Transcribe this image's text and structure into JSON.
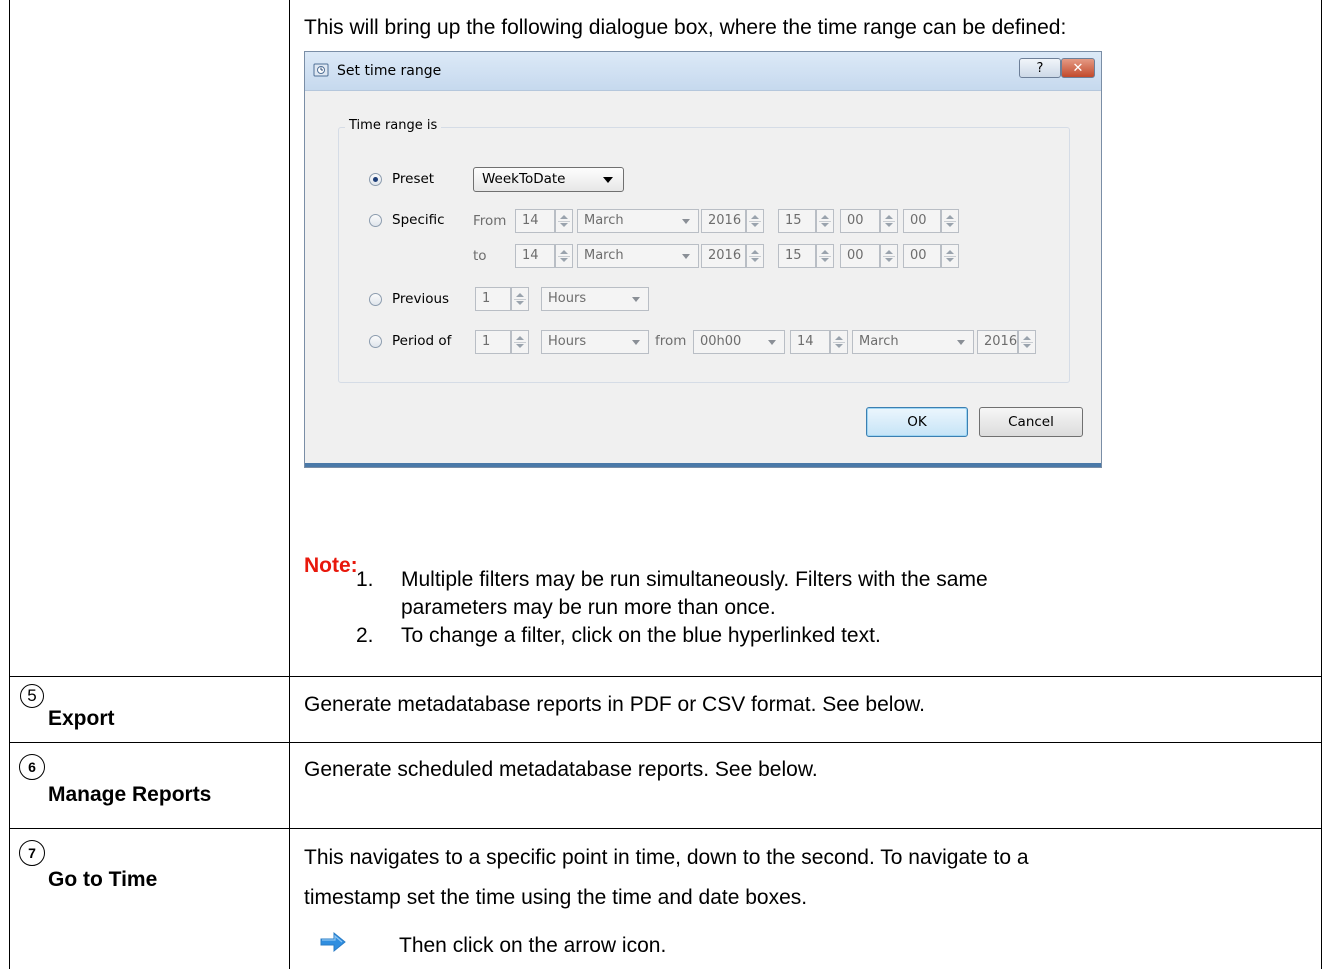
{
  "intro_text": "This will bring up the following dialogue box, where the time range can be defined:",
  "dialog": {
    "title": "Set time range",
    "help_button": "?",
    "close_button": "✕",
    "group_label": "Time range is",
    "preset": {
      "label": "Preset",
      "value": "WeekToDate"
    },
    "specific": {
      "label": "Specific",
      "from_label": "From",
      "to_label": "to",
      "from": {
        "day": "14",
        "month": "March",
        "year": "2016",
        "hour": "15",
        "minute": "00",
        "second": "00"
      },
      "to": {
        "day": "14",
        "month": "March",
        "year": "2016",
        "hour": "15",
        "minute": "00",
        "second": "00"
      }
    },
    "previous": {
      "label": "Previous",
      "count": "1",
      "unit": "Hours"
    },
    "period_of": {
      "label": "Period of",
      "count": "1",
      "unit": "Hours",
      "from_label": "from",
      "time": "00h00",
      "day": "14",
      "month": "March",
      "year": "2016"
    },
    "ok_button": "OK",
    "cancel_button": "Cancel"
  },
  "note": {
    "label": "Note:",
    "items": [
      {
        "num": "1.",
        "line1": "Multiple filters may be run simultaneously. Filters with the same",
        "line2": "parameters may be run more than once."
      },
      {
        "num": "2.",
        "line1": "To change a filter, click on the blue hyperlinked text."
      }
    ]
  },
  "rows": [
    {
      "number": "5",
      "label": "Export",
      "description": "Generate metadatabase reports in PDF or CSV format. See below."
    },
    {
      "number": "6",
      "label": "Manage Reports",
      "description": "Generate scheduled metadatabase reports. See below."
    },
    {
      "number": "7",
      "label": "Go to Time",
      "description_line1": "This navigates to a specific point in time, down to the second. To navigate to a",
      "description_line2": "timestamp set the time using the time and date boxes.",
      "arrow_text": "Then click on the arrow icon.",
      "arrow_icon": "right-arrow-icon",
      "arrow_color": "#2f8ee0"
    }
  ],
  "colors": {
    "note_label": "#e8180c",
    "dialog_frame": "#4a79a8"
  }
}
